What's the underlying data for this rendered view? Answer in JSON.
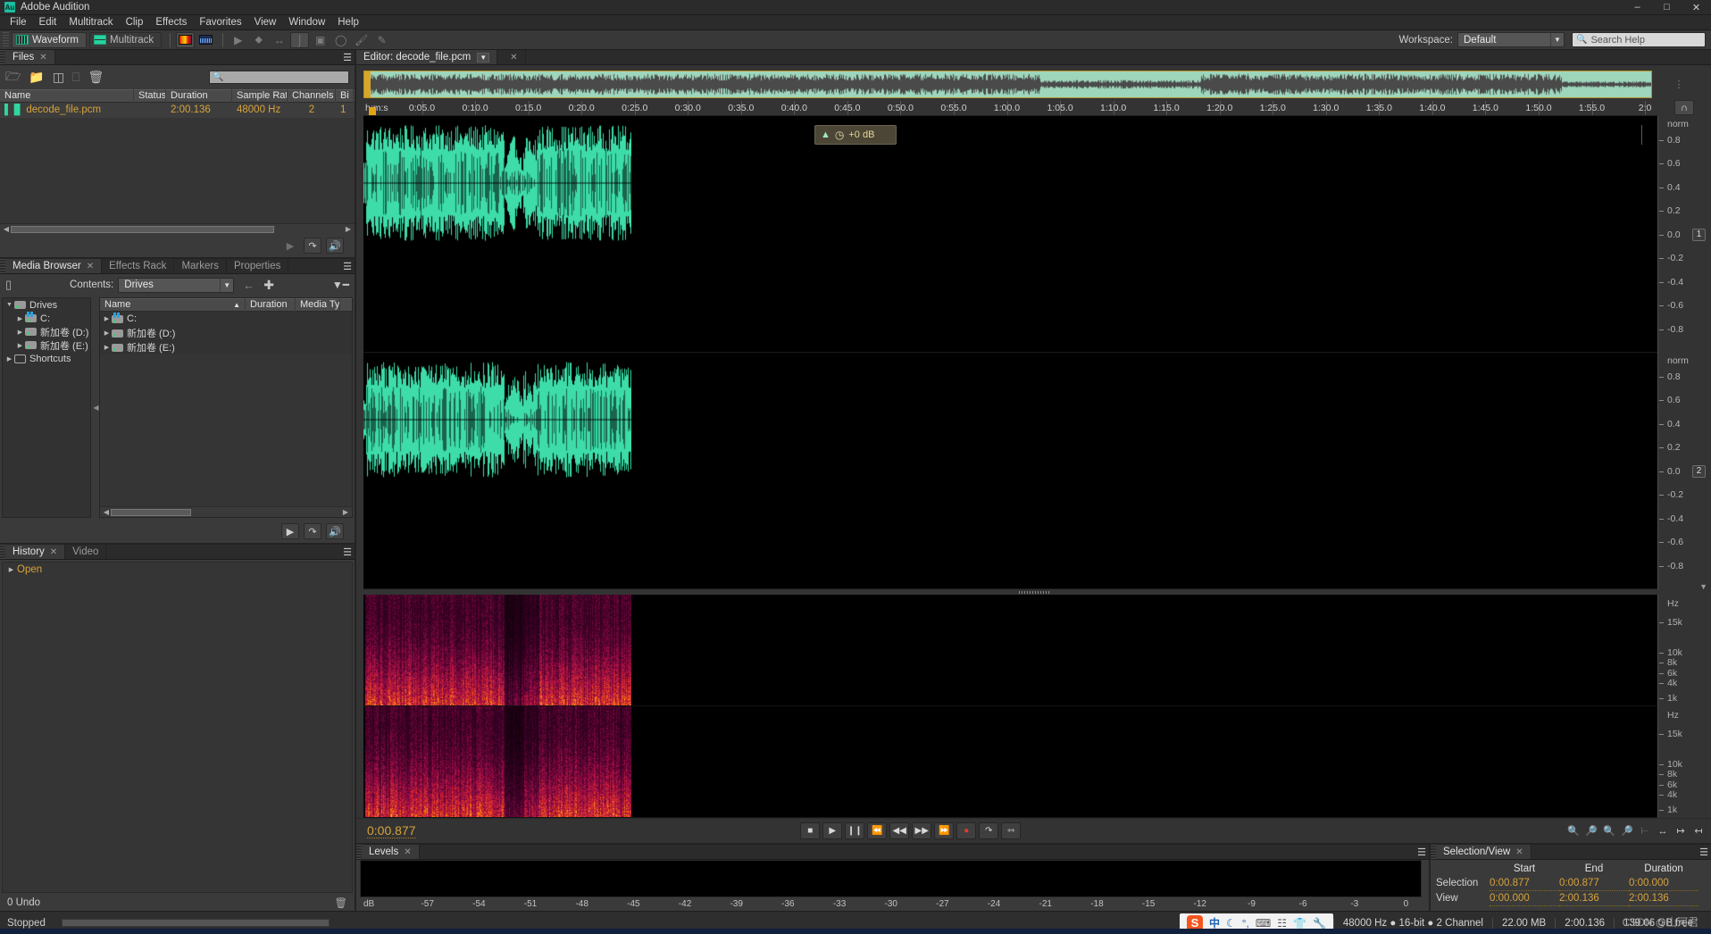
{
  "app": {
    "title": "Adobe Audition",
    "logo": "Au",
    "window_buttons": [
      "minimize",
      "maximize",
      "close"
    ]
  },
  "menubar": [
    "File",
    "Edit",
    "Multitrack",
    "Clip",
    "Effects",
    "Favorites",
    "View",
    "Window",
    "Help"
  ],
  "toolbar": {
    "waveform_label": "Waveform",
    "multitrack_label": "Multitrack",
    "workspace_label": "Workspace:",
    "workspace_value": "Default",
    "search_help_placeholder": "Search Help"
  },
  "files_panel": {
    "tab": "Files",
    "columns": [
      "Name",
      "Status",
      "Duration",
      "Sample Rate",
      "Channels",
      "Bi"
    ],
    "rows": [
      {
        "name": "decode_file.pcm",
        "status": "",
        "duration": "2:00.136",
        "sample_rate": "48000 Hz",
        "channels": "2",
        "bit": "1"
      }
    ]
  },
  "media_panel": {
    "tabs": [
      "Media Browser",
      "Effects Rack",
      "Markers",
      "Properties"
    ],
    "active_tab": "Media Browser",
    "contents_label": "Contents:",
    "contents_value": "Drives",
    "tree": [
      {
        "label": "Drives",
        "level": 0,
        "expanded": true
      },
      {
        "label": "C:",
        "level": 1,
        "expanded": false
      },
      {
        "label": "新加卷 (D:)",
        "level": 1,
        "expanded": false
      },
      {
        "label": "新加卷 (E:)",
        "level": 1,
        "expanded": false
      },
      {
        "label": "Shortcuts",
        "level": 0,
        "expanded": false
      }
    ],
    "list_columns": [
      "Name",
      "Duration",
      "Media Ty"
    ],
    "list_rows": [
      {
        "name": "C:",
        "duration": "",
        "type": ""
      },
      {
        "name": "新加卷 (D:)",
        "duration": "",
        "type": ""
      },
      {
        "name": "新加卷 (E:)",
        "duration": "",
        "type": ""
      }
    ]
  },
  "history_panel": {
    "tabs": [
      "History",
      "Video"
    ],
    "active_tab": "History",
    "items": [
      "Open"
    ],
    "undo_status": "0 Undo"
  },
  "editor": {
    "tab_title": "Editor: decode_file.pcm",
    "ruler": {
      "origin_label": "h:m:s",
      "labels": [
        "0:05.0",
        "0:10.0",
        "0:15.0",
        "0:20.0",
        "0:25.0",
        "0:30.0",
        "0:35.0",
        "0:40.0",
        "0:45.0",
        "0:50.0",
        "0:55.0",
        "1:00.0",
        "1:05.0",
        "1:10.0",
        "1:15.0",
        "1:20.0",
        "1:25.0",
        "1:30.0",
        "1:35.0",
        "1:40.0",
        "1:45.0",
        "1:50.0",
        "1:55.0",
        "2:0"
      ]
    },
    "amplitude_scale": {
      "unit": "norm",
      "ticks": [
        "0.8",
        "0.6",
        "0.4",
        "0.2",
        "0.0",
        "-0.2",
        "-0.4",
        "-0.6",
        "-0.8"
      ]
    },
    "channel_labels": [
      "1",
      "2"
    ],
    "frequency_scale": {
      "unit": "Hz",
      "ticks": [
        "15k",
        "10k",
        "8k",
        "6k",
        "4k",
        "1k"
      ]
    },
    "gain_overlay": "+0 dB",
    "timecode": "0:00.877",
    "transport_buttons": [
      "stop",
      "play",
      "pause",
      "skip-start",
      "rewind",
      "fast-forward",
      "skip-end",
      "record",
      "loop",
      "metronome"
    ],
    "snap_label": "snap-icon"
  },
  "levels_panel": {
    "tab": "Levels",
    "db_label": "dB",
    "db_ticks": [
      "-57",
      "-54",
      "-51",
      "-48",
      "-45",
      "-42",
      "-39",
      "-36",
      "-33",
      "-30",
      "-27",
      "-24",
      "-21",
      "-18",
      "-15",
      "-12",
      "-9",
      "-6",
      "-3",
      "0"
    ]
  },
  "selection_view": {
    "tab": "Selection/View",
    "columns": [
      "Start",
      "End",
      "Duration"
    ],
    "rows": [
      {
        "label": "Selection",
        "start": "0:00.877",
        "end": "0:00.877",
        "duration": "0:00.000"
      },
      {
        "label": "View",
        "start": "0:00.000",
        "end": "2:00.136",
        "duration": "2:00.136"
      }
    ]
  },
  "status_bar": {
    "state": "Stopped",
    "sample_info": "48000 Hz ● 16-bit ● 2 Channel",
    "file_size": "22.00 MB",
    "duration": "2:00.136",
    "free_space": "139.06 GB free",
    "watermark": "CSDN @山河君",
    "ime": {
      "logo": "S",
      "lang": "中",
      "glyphs": [
        "☽",
        "°,",
        "⌨",
        "☷",
        "♥",
        "⚒"
      ]
    }
  },
  "colors": {
    "waveform": "#3ddca8",
    "accent_text": "#d7a33c",
    "panel_bg": "#3a3a3a",
    "app_bg": "#333333",
    "spectral_hot": "#ffd000",
    "spectral_mid": "#e8412a",
    "spectral_cool": "#6b1040"
  }
}
